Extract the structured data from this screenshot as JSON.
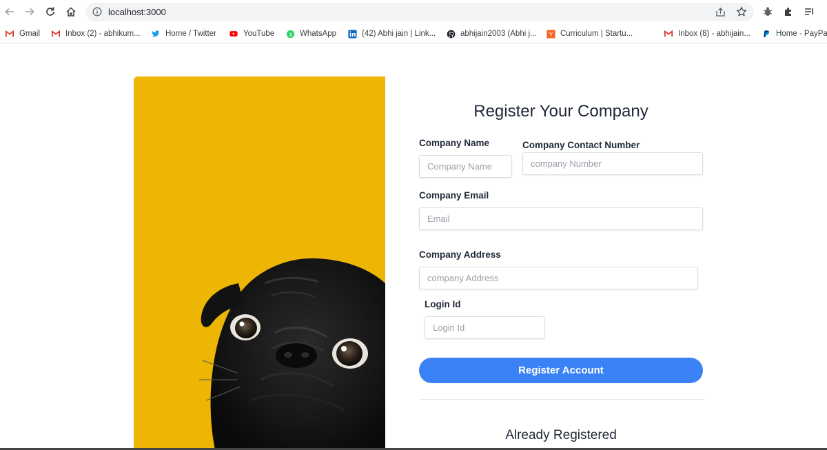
{
  "browser": {
    "url": "localhost:3000",
    "bookmarks": [
      {
        "label": "Gmail",
        "icon": "gmail-icon"
      },
      {
        "label": "Inbox (2) - abhikum...",
        "icon": "gmail-icon"
      },
      {
        "label": "Home / Twitter",
        "icon": "twitter-icon"
      },
      {
        "label": "YouTube",
        "icon": "youtube-icon"
      },
      {
        "label": "WhatsApp",
        "icon": "whatsapp-icon"
      },
      {
        "label": "(42) Abhi jain | Link...",
        "icon": "linkedin-icon"
      },
      {
        "label": "abhijain2003 (Abhi j...",
        "icon": "github-icon"
      },
      {
        "label": "Curriculum | Startu...",
        "icon": "ycombinator-icon"
      },
      {
        "label": "Inbox (8) - abhijain...",
        "icon": "gmail-icon"
      },
      {
        "label": "Home - PayPal",
        "icon": "paypal-icon"
      }
    ]
  },
  "form": {
    "title": "Register Your Company",
    "company_name": {
      "label": "Company Name",
      "placeholder": "Company Name",
      "value": ""
    },
    "contact_number": {
      "label": "Company Contact Number",
      "placeholder": "company Number",
      "value": ""
    },
    "email": {
      "label": "Company Email",
      "placeholder": "Email",
      "value": ""
    },
    "address": {
      "label": "Company Address",
      "placeholder": "company Address",
      "value": ""
    },
    "login_id": {
      "label": "Login Id",
      "placeholder": "Login Id",
      "value": ""
    },
    "submit_label": "Register Account",
    "already_registered": "Already Registered"
  },
  "colors": {
    "accent": "#3b82f6",
    "hero_background": "#edb504"
  }
}
